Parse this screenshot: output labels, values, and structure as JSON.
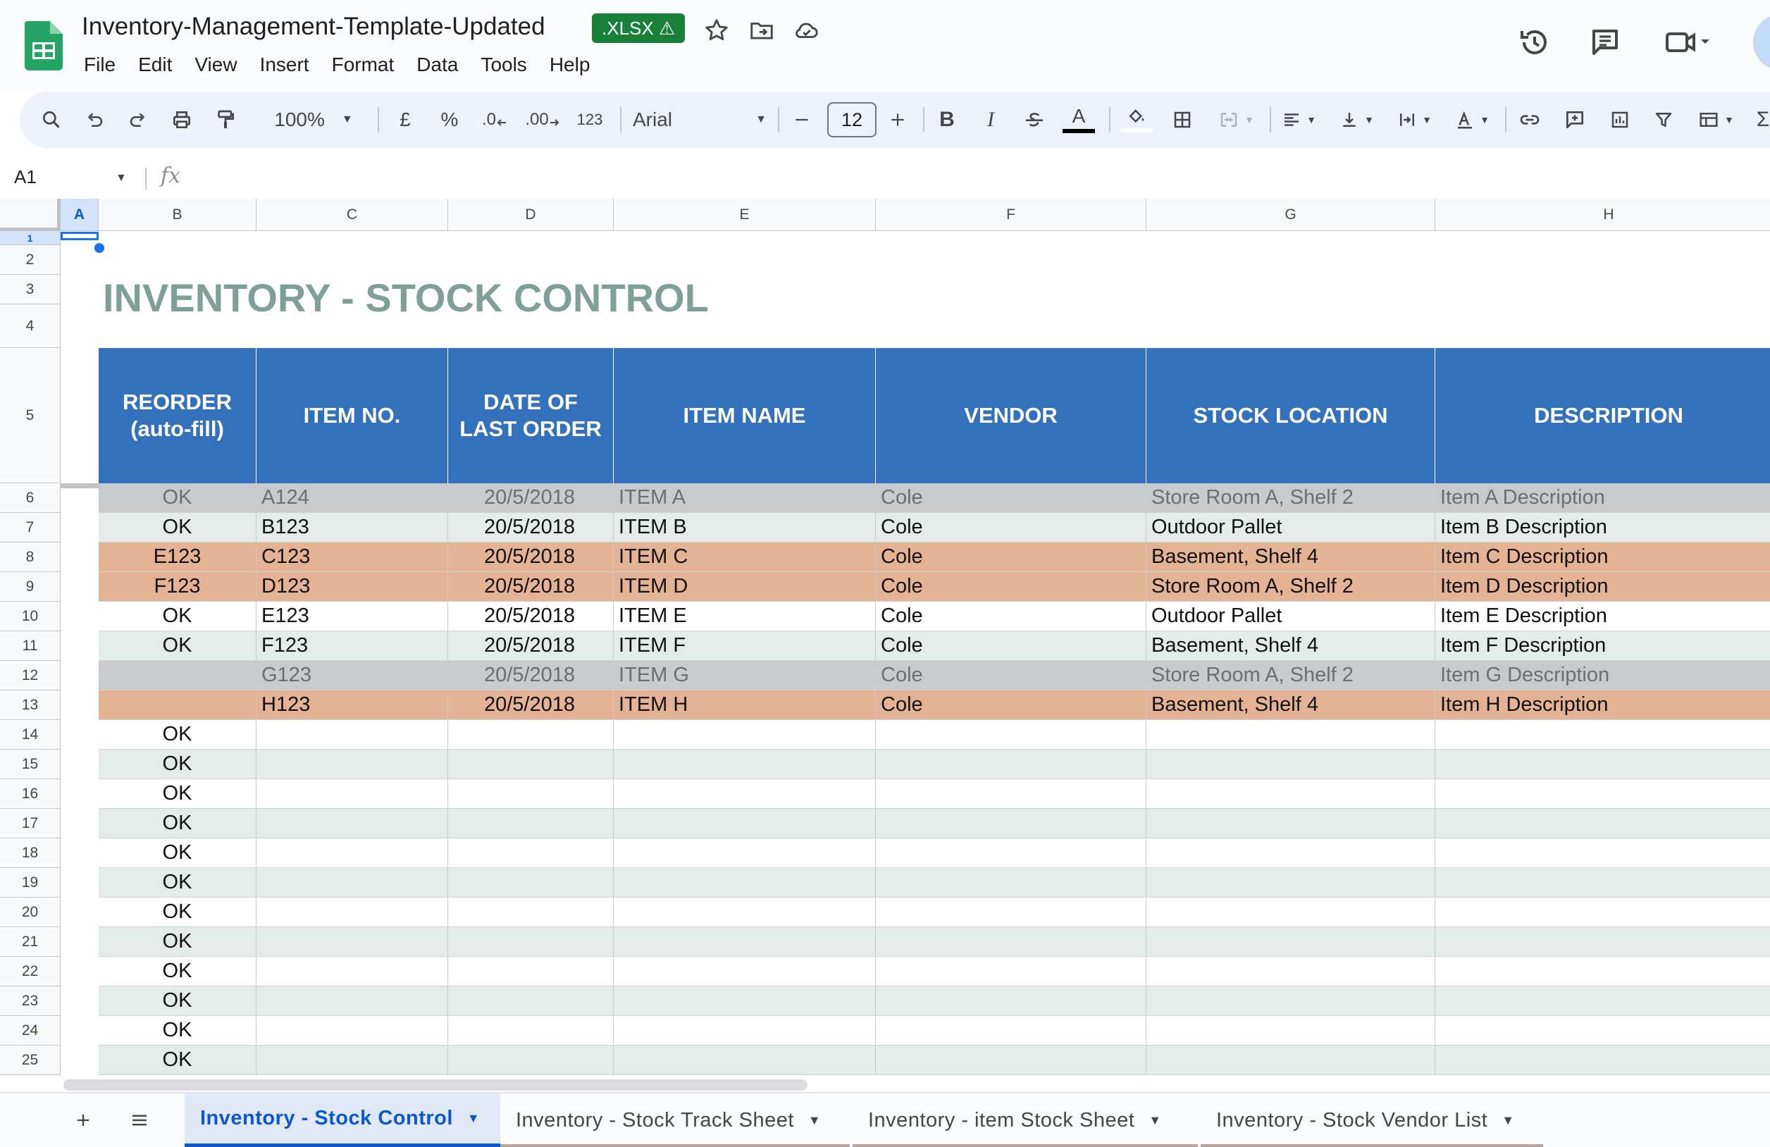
{
  "app": {
    "title": "Inventory-Management-Template-Updated",
    "badge": ".XLSX ⚠",
    "menu": [
      "File",
      "Edit",
      "View",
      "Insert",
      "Format",
      "Data",
      "Tools",
      "Help"
    ]
  },
  "toolbar": {
    "zoom": "100%",
    "currency": "£",
    "percent": "%",
    "decrease_decimal": ".0",
    "increase_decimal": ".00",
    "number_format": "123",
    "font": "Arial",
    "font_size": "12",
    "bold": "B",
    "italic": "I",
    "text_color_letter": "A"
  },
  "formula_bar": {
    "name_box": "A1",
    "fx_label": "fx",
    "value": ""
  },
  "grid": {
    "columns": [
      "A",
      "B",
      "C",
      "D",
      "E",
      "F",
      "G",
      "H"
    ],
    "selected_column": "A",
    "row_numbers": [
      "1",
      "2",
      "3",
      "4",
      "5",
      "6",
      "7",
      "8",
      "9",
      "10",
      "11",
      "12",
      "13",
      "14",
      "15",
      "16",
      "17",
      "18",
      "19",
      "20",
      "21",
      "22",
      "23",
      "24",
      "25"
    ],
    "selected_cell": "A1",
    "sheet_title": "INVENTORY - STOCK CONTROL",
    "headers": [
      {
        "line1": "REORDER",
        "line2": "(auto-fill)"
      },
      {
        "line1": "ITEM NO.",
        "line2": ""
      },
      {
        "line1": "DATE OF",
        "line2": "LAST ORDER"
      },
      {
        "line1": "ITEM NAME",
        "line2": ""
      },
      {
        "line1": "VENDOR",
        "line2": ""
      },
      {
        "line1": "STOCK LOCATION",
        "line2": ""
      },
      {
        "line1": "DESCRIPTION",
        "line2": ""
      }
    ],
    "rows": [
      {
        "reorder": "OK",
        "item_no": "A124",
        "date": "20/5/2018",
        "item_name": "ITEM A",
        "vendor": "Cole",
        "location": "Store Room A, Shelf 2",
        "description": "Item A Description"
      },
      {
        "reorder": "OK",
        "item_no": "B123",
        "date": "20/5/2018",
        "item_name": "ITEM B",
        "vendor": "Cole",
        "location": "Outdoor Pallet",
        "description": "Item B Description"
      },
      {
        "reorder": "E123",
        "item_no": "C123",
        "date": "20/5/2018",
        "item_name": "ITEM C",
        "vendor": "Cole",
        "location": "Basement, Shelf 4",
        "description": "Item C Description"
      },
      {
        "reorder": "F123",
        "item_no": "D123",
        "date": "20/5/2018",
        "item_name": "ITEM D",
        "vendor": "Cole",
        "location": "Store Room A, Shelf 2",
        "description": "Item D Description"
      },
      {
        "reorder": "OK",
        "item_no": "E123",
        "date": "20/5/2018",
        "item_name": "ITEM E",
        "vendor": "Cole",
        "location": "Outdoor Pallet",
        "description": "Item E Description"
      },
      {
        "reorder": "OK",
        "item_no": "F123",
        "date": "20/5/2018",
        "item_name": "ITEM F",
        "vendor": "Cole",
        "location": "Basement, Shelf 4",
        "description": "Item F Description"
      },
      {
        "reorder": "",
        "item_no": "G123",
        "date": "20/5/2018",
        "item_name": "ITEM G",
        "vendor": "Cole",
        "location": "Store Room A, Shelf 2",
        "description": "Item G Description"
      },
      {
        "reorder": "",
        "item_no": "H123",
        "date": "20/5/2018",
        "item_name": "ITEM H",
        "vendor": "Cole",
        "location": "Basement, Shelf 4",
        "description": "Item H Description"
      },
      {
        "reorder": "OK",
        "item_no": "",
        "date": "",
        "item_name": "",
        "vendor": "",
        "location": "",
        "description": ""
      },
      {
        "reorder": "OK",
        "item_no": "",
        "date": "",
        "item_name": "",
        "vendor": "",
        "location": "",
        "description": ""
      },
      {
        "reorder": "OK",
        "item_no": "",
        "date": "",
        "item_name": "",
        "vendor": "",
        "location": "",
        "description": ""
      },
      {
        "reorder": "OK",
        "item_no": "",
        "date": "",
        "item_name": "",
        "vendor": "",
        "location": "",
        "description": ""
      },
      {
        "reorder": "OK",
        "item_no": "",
        "date": "",
        "item_name": "",
        "vendor": "",
        "location": "",
        "description": ""
      },
      {
        "reorder": "OK",
        "item_no": "",
        "date": "",
        "item_name": "",
        "vendor": "",
        "location": "",
        "description": ""
      },
      {
        "reorder": "OK",
        "item_no": "",
        "date": "",
        "item_name": "",
        "vendor": "",
        "location": "",
        "description": ""
      },
      {
        "reorder": "OK",
        "item_no": "",
        "date": "",
        "item_name": "",
        "vendor": "",
        "location": "",
        "description": ""
      },
      {
        "reorder": "OK",
        "item_no": "",
        "date": "",
        "item_name": "",
        "vendor": "",
        "location": "",
        "description": ""
      },
      {
        "reorder": "OK",
        "item_no": "",
        "date": "",
        "item_name": "",
        "vendor": "",
        "location": "",
        "description": ""
      },
      {
        "reorder": "OK",
        "item_no": "",
        "date": "",
        "item_name": "",
        "vendor": "",
        "location": "",
        "description": ""
      },
      {
        "reorder": "OK",
        "item_no": "",
        "date": "",
        "item_name": "",
        "vendor": "",
        "location": "",
        "description": ""
      }
    ],
    "row_styles": [
      "grey",
      "light",
      "orange",
      "orange",
      "white",
      "light",
      "grey",
      "orange",
      "white",
      "light",
      "white",
      "light",
      "white",
      "light",
      "white",
      "light",
      "white",
      "light",
      "white",
      "light"
    ]
  },
  "colors": {
    "header_blue": "#3371bd",
    "title_green": "#7f9f99",
    "row_grey": "#c9cacb",
    "row_light": "#e4ecea",
    "row_orange": "#e4b395",
    "row_white": "#ffffff",
    "badge_green": "#188038",
    "accent": "#0b57d0"
  },
  "sheet_tabs": [
    {
      "label": "Inventory - Stock Control",
      "active": true
    },
    {
      "label": "Inventory - Stock Track Sheet",
      "active": false
    },
    {
      "label": "Inventory - item Stock Sheet",
      "active": false
    },
    {
      "label": "Inventory - Stock Vendor List",
      "active": false
    }
  ]
}
